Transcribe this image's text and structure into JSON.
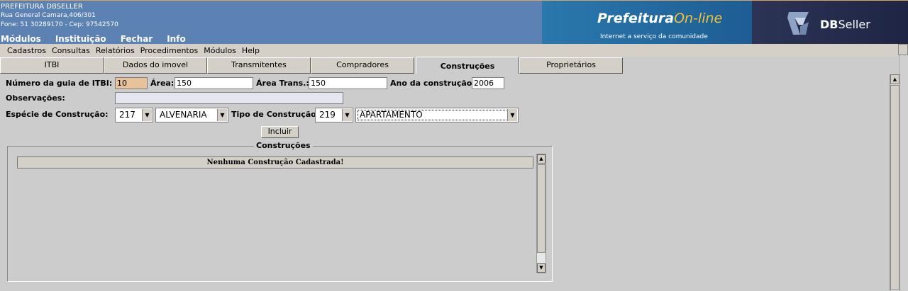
{
  "header": {
    "org_name": "PREFEITURA DBSELLER",
    "address": "Rua General Camara,406/301",
    "phone": "Fone: 51 30289170  -  Cep: 97542570",
    "menu": [
      "Módulos",
      "Instituição",
      "Fechar",
      "Info"
    ],
    "logo_brand": "Prefeitura",
    "logo_online": "On-line",
    "logo_tagline": "Internet a serviço da comunidade",
    "vendor_bold": "DB",
    "vendor_light": "Seller"
  },
  "app_menu": [
    "Cadastros",
    "Consultas",
    "Relatórios",
    "Procedimentos",
    "Módulos",
    "Help"
  ],
  "tabs": [
    {
      "label": "ITBI"
    },
    {
      "label": "Dados do imovel"
    },
    {
      "label": "Transmitentes"
    },
    {
      "label": "Compradores"
    },
    {
      "label": "Construções",
      "active": true
    },
    {
      "label": "Proprietários"
    }
  ],
  "form": {
    "guia_label": "Número da guia de ITBI:",
    "guia_value": "10",
    "area_label": "Área:",
    "area_value": "150",
    "area_trans_label": "Área Trans.:",
    "area_trans_value": "150",
    "ano_label": "Ano da construção:",
    "ano_value": "2006",
    "obs_label": "Observações:",
    "obs_value": "",
    "especie_label": "Espécie de Construção:",
    "especie_code": "217",
    "especie_desc": "ALVENARIA",
    "tipo_label": "Tipo de Construção:",
    "tipo_code": "219",
    "tipo_desc": "APARTAMENTO",
    "incluir_label": "Incluir"
  },
  "construcoes": {
    "legend": "Construções",
    "empty_message": "Nenhuma Construção Cadastrada!"
  },
  "colors": {
    "header_bg": "#5b82b2",
    "readonly_field": "#e8c39a",
    "panel_bg": "#cccccc"
  }
}
